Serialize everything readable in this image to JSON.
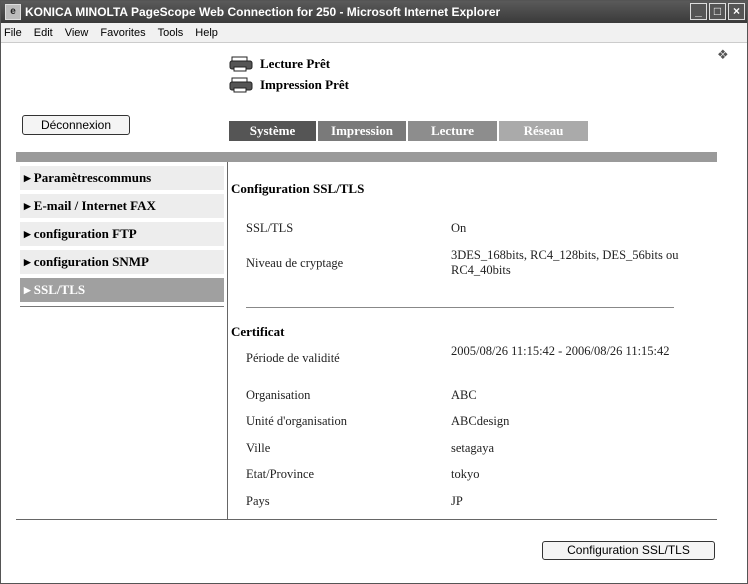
{
  "window": {
    "title": "KONICA MINOLTA PageScope Web Connection for 250 - Microsoft Internet Explorer",
    "menu": [
      "File",
      "Edit",
      "View",
      "Favorites",
      "Tools",
      "Help"
    ]
  },
  "header": {
    "status": [
      "Lecture Prêt",
      "Impression Prêt"
    ],
    "logout_label": "Déconnexion",
    "tabs": [
      "Système",
      "Impression",
      "Lecture",
      "Réseau"
    ],
    "active_tab": "Système"
  },
  "sidebar": {
    "items": [
      "Paramètrescommuns",
      "E-mail / Internet FAX",
      "configuration FTP",
      "configuration SNMP",
      "SSL/TLS"
    ],
    "active": "SSL/TLS"
  },
  "ssl": {
    "title": "Configuration SSL/TLS",
    "rows": [
      {
        "label": "SSL/TLS",
        "value": "On"
      },
      {
        "label": "Niveau de cryptage",
        "value": "3DES_168bits, RC4_128bits, DES_56bits ou RC4_40bits"
      }
    ]
  },
  "certificate": {
    "title": "Certificat",
    "rows": [
      {
        "label": "Période de validité",
        "value": "2005/08/26 11:15:42 - 2006/08/26 11:15:42"
      },
      {
        "label": "Organisation",
        "value": "ABC"
      },
      {
        "label": "Unité d'organisation",
        "value": "ABCdesign"
      },
      {
        "label": "Ville",
        "value": "setagaya"
      },
      {
        "label": "Etat/Province",
        "value": "tokyo"
      },
      {
        "label": "Pays",
        "value": "JP"
      }
    ]
  },
  "footer": {
    "button_label": "Configuration SSL/TLS"
  }
}
